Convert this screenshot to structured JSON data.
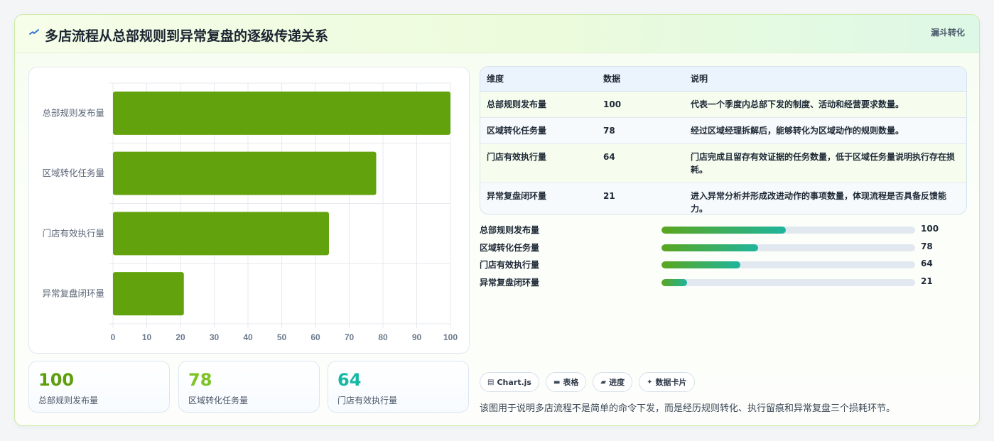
{
  "header": {
    "title": "多店流程从总部规则到异常复盘的逐级传递关系",
    "tag": "漏斗转化",
    "icon": "lightning-icon"
  },
  "colors": {
    "bar": "#62a30d",
    "stat_1": "#5d9e0b",
    "stat_2": "#7dc323",
    "stat_3": "#15b8a2",
    "progress_start": "#5aa61e",
    "progress_end": "#1fb59c"
  },
  "chart_data": {
    "type": "bar",
    "orientation": "horizontal",
    "categories": [
      "总部规则发布量",
      "区域转化任务量",
      "门店有效执行量",
      "异常复盘闭环量"
    ],
    "values": [
      100,
      78,
      64,
      21
    ],
    "xlim": [
      0,
      100
    ],
    "x_ticks": [
      0,
      10,
      20,
      30,
      40,
      50,
      60,
      70,
      80,
      90,
      100
    ],
    "grid": true,
    "legend": "none"
  },
  "stats": [
    {
      "value": "100",
      "label": "总部规则发布量"
    },
    {
      "value": "78",
      "label": "区域转化任务量"
    },
    {
      "value": "64",
      "label": "门店有效执行量"
    }
  ],
  "table": {
    "headers": [
      "维度",
      "数据",
      "说明"
    ],
    "rows": [
      {
        "dim": "总部规则发布量",
        "value": "100",
        "note": "代表一个季度内总部下发的制度、活动和经营要求数量。"
      },
      {
        "dim": "区域转化任务量",
        "value": "78",
        "note": "经过区域经理拆解后，能够转化为区域动作的规则数量。"
      },
      {
        "dim": "门店有效执行量",
        "value": "64",
        "note": "门店完成且留存有效证据的任务数量，低于区域任务量说明执行存在损耗。"
      },
      {
        "dim": "异常复盘闭环量",
        "value": "21",
        "note": "进入异常分析并形成改进动作的事项数量，体现流程是否具备反馈能力。"
      }
    ]
  },
  "progress": [
    {
      "label": "总部规则发布量",
      "value": 100,
      "display": "100",
      "fill_pct": 49
    },
    {
      "label": "区域转化任务量",
      "value": 78,
      "display": "78",
      "fill_pct": 38
    },
    {
      "label": "门店有效执行量",
      "value": 64,
      "display": "64",
      "fill_pct": 31
    },
    {
      "label": "异常复盘闭环量",
      "value": 21,
      "display": "21",
      "fill_pct": 10
    }
  ],
  "chips": [
    {
      "icon": "chart-icon",
      "glyph": "▤",
      "label": "Chart.js"
    },
    {
      "icon": "table-icon",
      "glyph": "▬",
      "label": "表格"
    },
    {
      "icon": "progress-icon",
      "glyph": "▰",
      "label": "进度"
    },
    {
      "icon": "sparkle-icon",
      "glyph": "✦",
      "label": "数据卡片"
    }
  ],
  "description": "该图用于说明多店流程不是简单的命令下发，而是经历规则转化、执行留痕和异常复盘三个损耗环节。"
}
